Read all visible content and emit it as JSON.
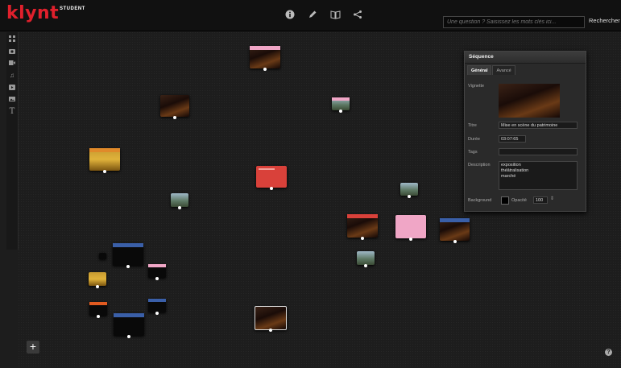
{
  "app": {
    "logo": "klynt",
    "edition": "STUDENT"
  },
  "toolbar": {
    "icons": [
      "info-icon",
      "pencil-icon",
      "book-icon",
      "share-icon"
    ]
  },
  "search": {
    "placeholder": "Une question ? Saisissez les mots clés ici...",
    "button": "Rechercher"
  },
  "sidebar": {
    "icons": [
      "grid-icon",
      "photo-icon",
      "video-icon",
      "music-icon",
      "play-icon",
      "image-icon",
      "text-icon"
    ]
  },
  "panel": {
    "title": "Séquence",
    "tabs": [
      "Général",
      "Avancé"
    ],
    "labels": {
      "vignette": "Vignette",
      "titre": "Titre",
      "duree": "Durée",
      "tags": "Tags",
      "description": "Description",
      "background": "Background",
      "opacite": "Opacité"
    },
    "values": {
      "titre": "Mise en scène du patrimoine",
      "duree": "03:07:65",
      "tags": "",
      "description_lines": [
        "exposition",
        "théâtralisation",
        "marché"
      ],
      "opacite": "100"
    }
  },
  "colors": {
    "logo": "#e0202c",
    "node_red": "#d9413a",
    "node_pink": "#f0a6c6"
  },
  "buttons": {
    "add": "+",
    "help": "?"
  }
}
